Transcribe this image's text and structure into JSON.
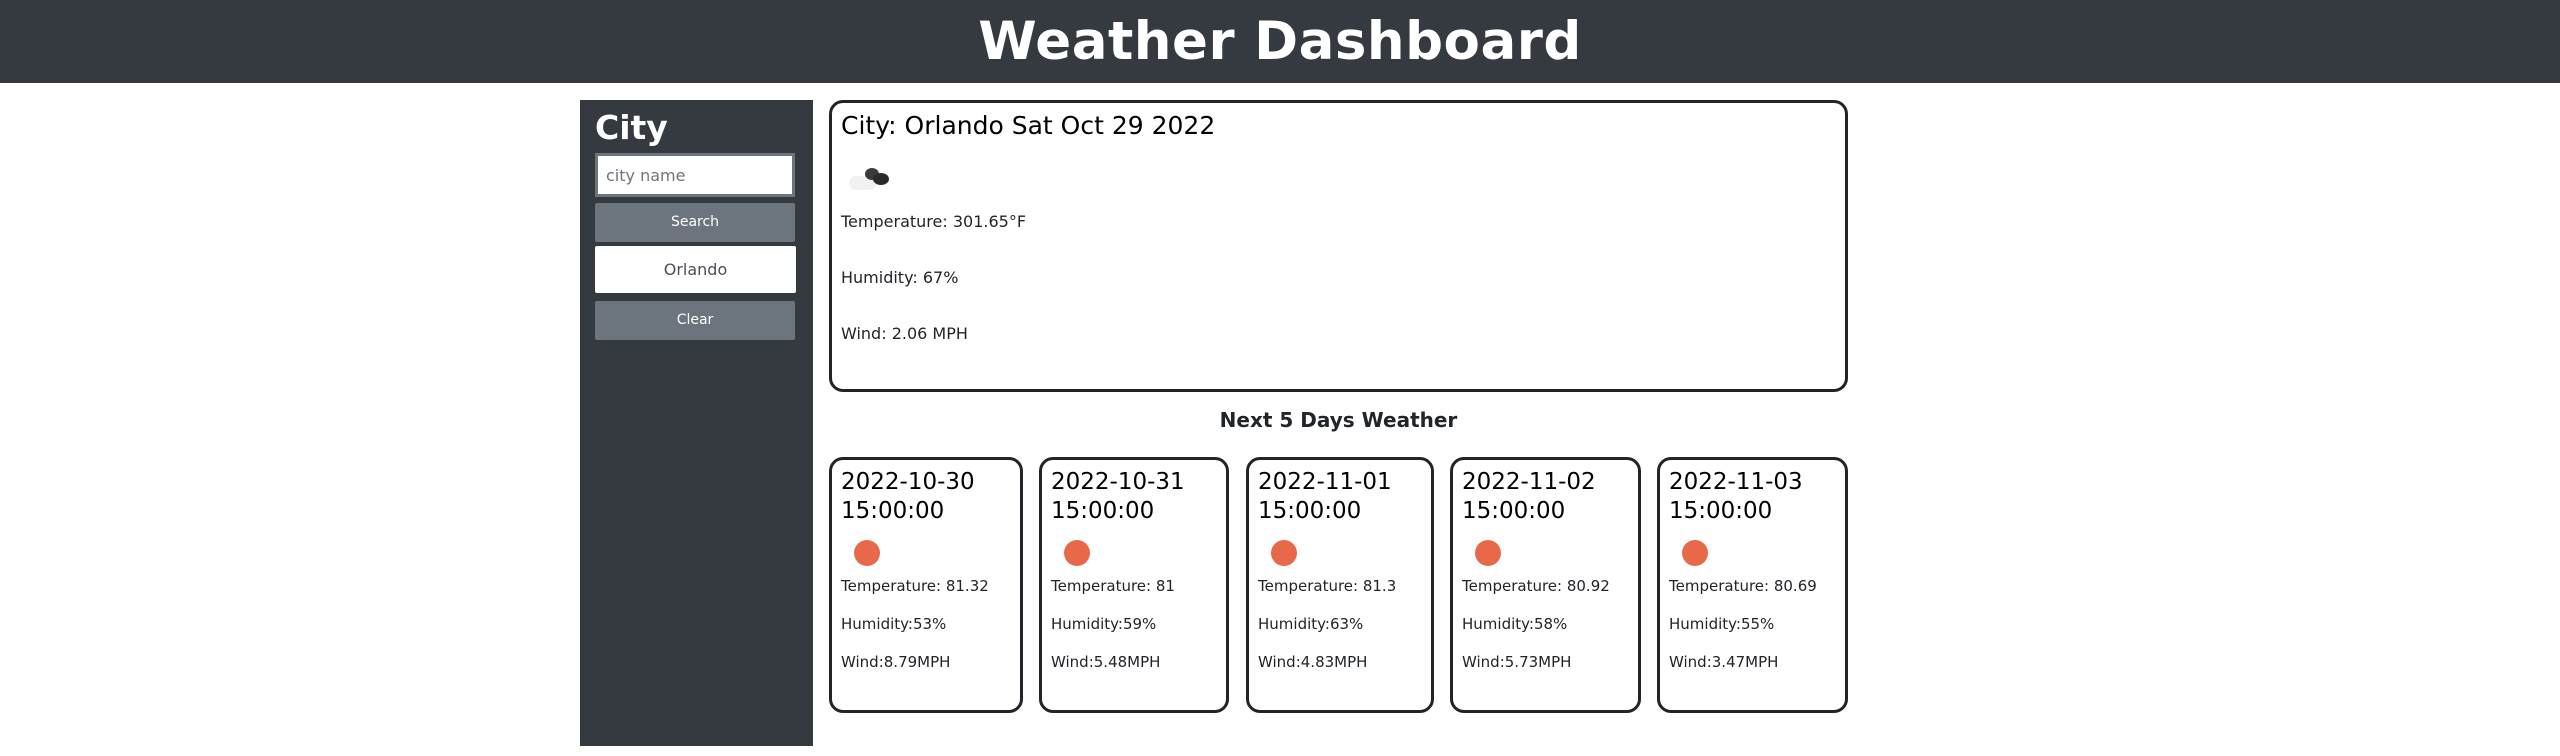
{
  "header": {
    "title": "Weather Dashboard"
  },
  "sidebar": {
    "title": "City",
    "search_placeholder": "city name",
    "search_label": "Search",
    "history": [
      "Orlando"
    ],
    "clear_label": "Clear"
  },
  "current": {
    "heading": "City: Orlando Sat Oct 29 2022",
    "icon": "cloud-icon",
    "temperature": "Temperature: 301.65°F",
    "humidity": "Humidity: 67%",
    "wind": "Wind: 2.06 MPH"
  },
  "forecast": {
    "title": "Next 5 Days Weather",
    "days": [
      {
        "date": "2022-10-30 15:00:00",
        "icon": "sun-icon",
        "temperature": "Temperature: 81.32",
        "humidity": "Humidity:53%",
        "wind": "Wind:8.79MPH"
      },
      {
        "date": "2022-10-31 15:00:00",
        "icon": "sun-icon",
        "temperature": "Temperature: 81",
        "humidity": "Humidity:59%",
        "wind": "Wind:5.48MPH"
      },
      {
        "date": "2022-11-01 15:00:00",
        "icon": "sun-icon",
        "temperature": "Temperature: 81.3",
        "humidity": "Humidity:63%",
        "wind": "Wind:4.83MPH"
      },
      {
        "date": "2022-11-02 15:00:00",
        "icon": "sun-icon",
        "temperature": "Temperature: 80.92",
        "humidity": "Humidity:58%",
        "wind": "Wind:5.73MPH"
      },
      {
        "date": "2022-11-03 15:00:00",
        "icon": "sun-icon",
        "temperature": "Temperature: 80.69",
        "humidity": "Humidity:55%",
        "wind": "Wind:3.47MPH"
      }
    ]
  },
  "colors": {
    "header_bg": "#343a40",
    "sidebar_bg": "#343a40",
    "button_gray": "#6c757d",
    "sun": "#e8694a"
  }
}
